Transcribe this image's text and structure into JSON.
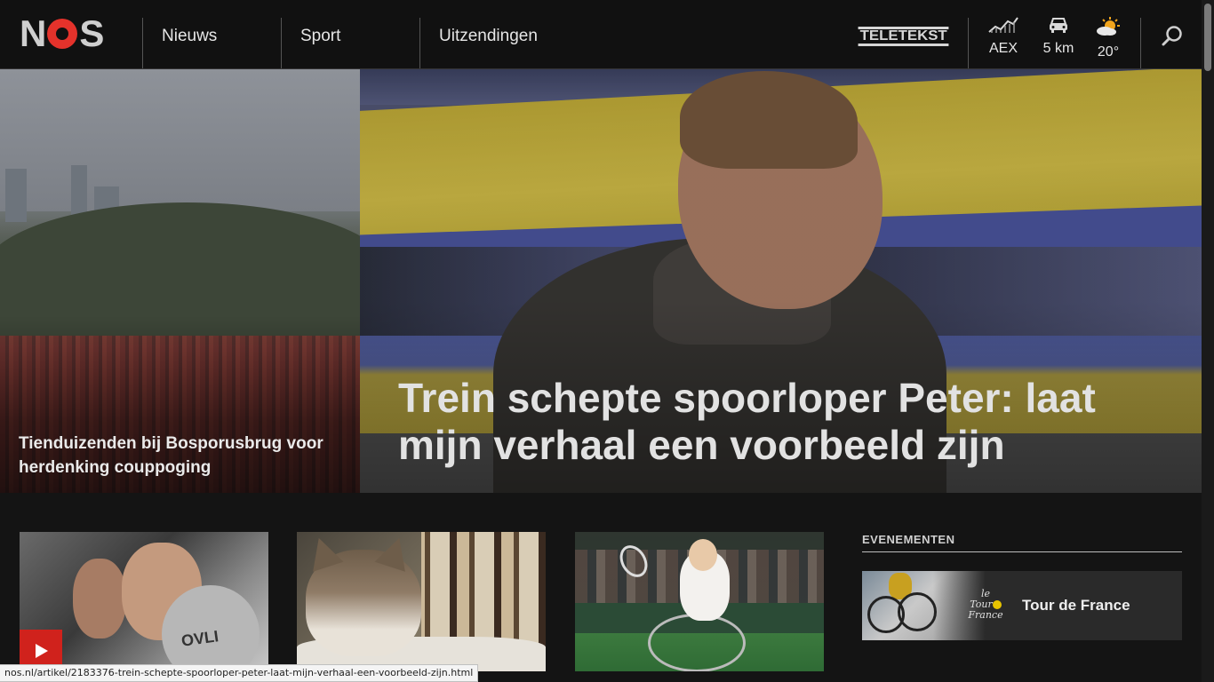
{
  "header": {
    "logo": "NOS",
    "nav": [
      {
        "label": "Nieuws"
      },
      {
        "label": "Sport"
      },
      {
        "label": "Uitzendingen"
      }
    ],
    "teletekst": "TELETEKST",
    "widgets": {
      "aex": {
        "label": "AEX",
        "icon": "stock-chart-icon"
      },
      "traffic": {
        "label": "5 km",
        "icon": "car-icon"
      },
      "weather": {
        "label": "20°",
        "icon": "sun-cloud-icon"
      }
    },
    "search_icon": "search-icon"
  },
  "hero": {
    "side": {
      "caption": "Tienduizenden bij Bosporusbrug voor herdenking couppoging"
    },
    "main": {
      "headline": "Trein schepte spoorloper Peter: laat mijn verhaal een voorbeeld zijn"
    }
  },
  "cards": [
    {
      "has_video": true,
      "ball_text": "OVLI"
    },
    {
      "has_video": false
    },
    {
      "has_video": false
    }
  ],
  "events": {
    "title": "EVENEMENTEN",
    "items": [
      {
        "label": "Tour de France",
        "logo_text_1": "le",
        "logo_text_2": "Tour",
        "logo_text_3": "France"
      }
    ]
  },
  "status_url": "nos.nl/artikel/2183376-trein-schepte-spoorloper-peter-laat-mijn-verhaal-een-voorbeeld-zijn.html",
  "colors": {
    "brand_red": "#e4322b",
    "header_bg": "#111111",
    "page_bg": "#141414"
  }
}
